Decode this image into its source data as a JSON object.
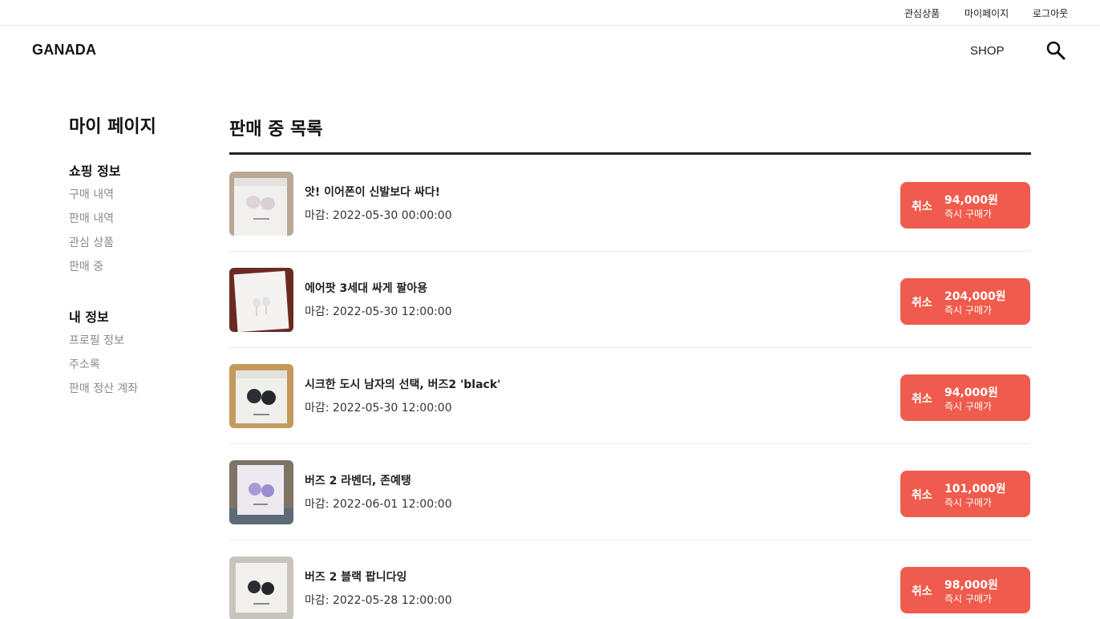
{
  "top_links": [
    "관심상품",
    "마이페이지",
    "로그아웃"
  ],
  "header": {
    "logo": "GANADA",
    "shop_label": "SHOP"
  },
  "sidebar": {
    "title": "마이 페이지",
    "groups": [
      {
        "title": "쇼핑 정보",
        "items": [
          "구매 내역",
          "판매 내역",
          "관심 상품",
          "판매 중"
        ]
      },
      {
        "title": "내 정보",
        "items": [
          "프로필 정보",
          "주소록",
          "판매 정산 계좌"
        ]
      }
    ]
  },
  "main": {
    "title": "판매 중 목록",
    "deadline_label": "마감:",
    "cancel_label": "취소",
    "price_sub_label": "즉시 구매가",
    "items": [
      {
        "title": "앗! 이어폰이 신발보다 싸다!",
        "deadline": "2022-05-30 00:00:00",
        "price": "94,000원",
        "image": "buds-white-box"
      },
      {
        "title": "에어팟 3세대 싸게 팔아용",
        "deadline": "2022-05-30 12:00:00",
        "price": "204,000원",
        "image": "airpods-white-box"
      },
      {
        "title": "시크한 도시 남자의 선택, 버즈2 'black'",
        "deadline": "2022-05-30 12:00:00",
        "price": "94,000원",
        "image": "buds-black-box"
      },
      {
        "title": "버즈 2 라벤더, 존예탱",
        "deadline": "2022-06-01 12:00:00",
        "price": "101,000원",
        "image": "buds-lavender-box"
      },
      {
        "title": "버즈 2 블랙 팝니다잉",
        "deadline": "2022-05-28 12:00:00",
        "price": "98,000원",
        "image": "buds-black-box-2"
      }
    ]
  },
  "colors": {
    "accent": "#ef5b4c",
    "rule": "#222222",
    "muted": "#8a8a8a"
  }
}
